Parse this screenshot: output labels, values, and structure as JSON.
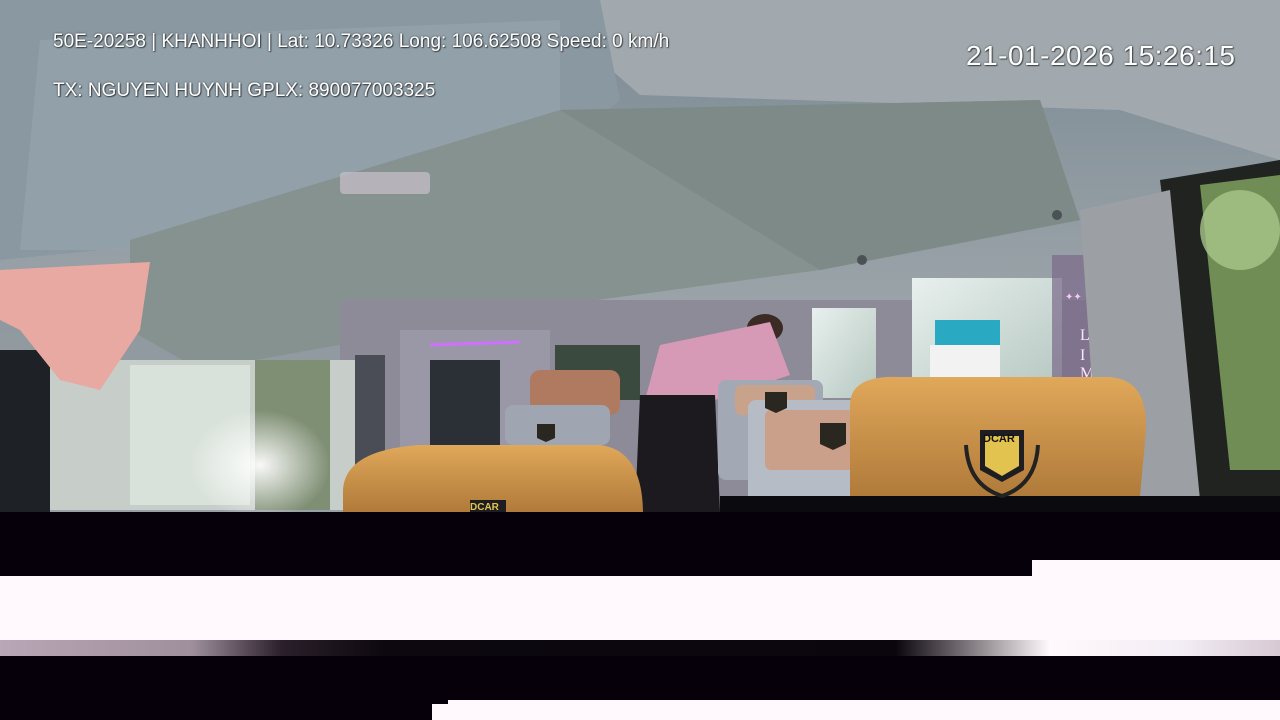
{
  "osd": {
    "line1": "50E-20258 | KHANHHOI | Lat: 10.73326 Long: 106.62508 Speed: 0 km/h",
    "line2": "TX: NGUYEN HUYNH GPLX: 890077003325",
    "timestamp": "21-01-2026 15:26:15"
  },
  "logos": {
    "seat_brand": "DCAR"
  }
}
